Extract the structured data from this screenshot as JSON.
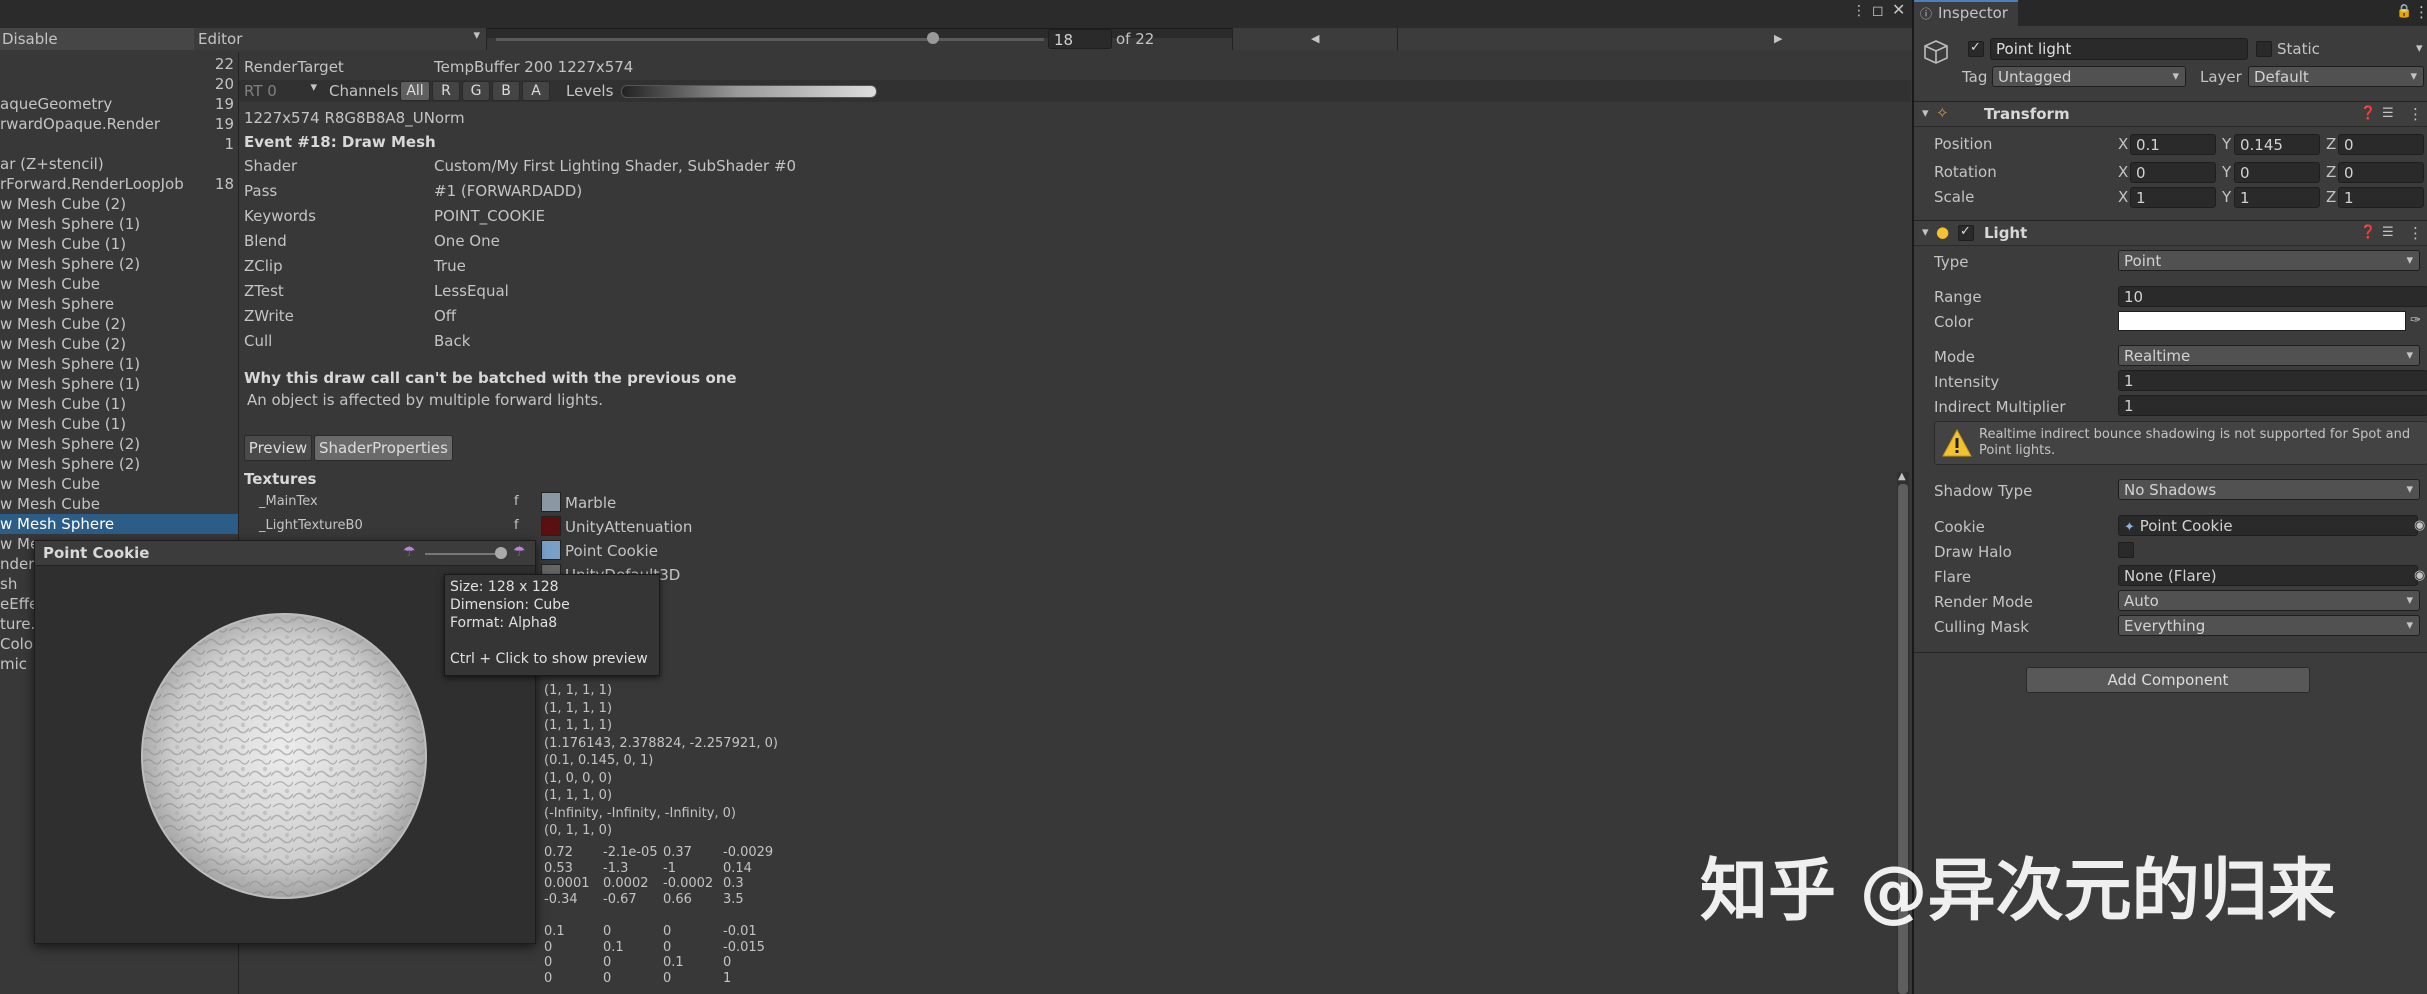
{
  "topbar": {
    "disable_label": "Disable",
    "editor_label": "Editor",
    "event_index": "18",
    "event_total": "of 22",
    "prev_icon": "triangle-left-icon",
    "next_icon": "triangle-right-icon"
  },
  "event_list": [
    {
      "label": "",
      "count": "22"
    },
    {
      "label": "",
      "count": "20"
    },
    {
      "label": "aqueGeometry",
      "count": "19"
    },
    {
      "label": "rwardOpaque.Render",
      "count": "19"
    },
    {
      "label": "",
      "count": "1"
    },
    {
      "label": "ar (Z+stencil)",
      "count": ""
    },
    {
      "label": "rForward.RenderLoopJob",
      "count": "18"
    },
    {
      "label": "w Mesh Cube (2)",
      "count": ""
    },
    {
      "label": "w Mesh Sphere (1)",
      "count": ""
    },
    {
      "label": "w Mesh Cube (1)",
      "count": ""
    },
    {
      "label": "w Mesh Sphere (2)",
      "count": ""
    },
    {
      "label": "w Mesh Cube",
      "count": ""
    },
    {
      "label": "w Mesh Sphere",
      "count": ""
    },
    {
      "label": "w Mesh Cube (2)",
      "count": ""
    },
    {
      "label": "w Mesh Cube (2)",
      "count": ""
    },
    {
      "label": "w Mesh Sphere (1)",
      "count": ""
    },
    {
      "label": "w Mesh Sphere (1)",
      "count": ""
    },
    {
      "label": "w Mesh Cube (1)",
      "count": ""
    },
    {
      "label": "w Mesh Cube (1)",
      "count": ""
    },
    {
      "label": "w Mesh Sphere (2)",
      "count": ""
    },
    {
      "label": "w Mesh Sphere (2)",
      "count": ""
    },
    {
      "label": "w Mesh Cube",
      "count": ""
    },
    {
      "label": "w Mesh Cube",
      "count": ""
    },
    {
      "label": "w Mesh Sphere",
      "count": "",
      "selected": true
    },
    {
      "label": "w Me",
      "count": ""
    },
    {
      "label": "nderS",
      "count": ""
    },
    {
      "label": "sh",
      "count": ""
    },
    {
      "label": "eEffe",
      "count": ""
    },
    {
      "label": "ture.F",
      "count": ""
    },
    {
      "label": "Color",
      "count": ""
    },
    {
      "label": "mic",
      "count": ""
    }
  ],
  "render_target": {
    "label": "RenderTarget",
    "value": "TempBuffer 200 1227x574",
    "rt_label": "RT 0",
    "channels_label": "Channels",
    "channels": [
      "All",
      "R",
      "G",
      "B",
      "A"
    ],
    "levels_label": "Levels",
    "format": "1227x574 R8G8B8A8_UNorm"
  },
  "event": {
    "title": "Event #18: Draw Mesh",
    "props": [
      {
        "name": "Shader",
        "value": "Custom/My First Lighting Shader, SubShader #0"
      },
      {
        "name": "Pass",
        "value": "#1 (FORWARDADD)"
      },
      {
        "name": "Keywords",
        "value": "POINT_COOKIE"
      },
      {
        "name": "Blend",
        "value": "One One"
      },
      {
        "name": "ZClip",
        "value": "True"
      },
      {
        "name": "ZTest",
        "value": "LessEqual"
      },
      {
        "name": "ZWrite",
        "value": "Off"
      },
      {
        "name": "Cull",
        "value": "Back"
      }
    ],
    "batch_title": "Why this draw call can't be batched with the previous one",
    "batch_reason": "An object is affected by multiple forward lights.",
    "tabs": [
      "Preview",
      "ShaderProperties"
    ],
    "textures_label": "Textures",
    "textures": [
      {
        "name": "_MainTex",
        "stage": "f",
        "value": "Marble"
      },
      {
        "name": "_LightTextureB0",
        "stage": "f",
        "value": "UnityAttenuation"
      },
      {
        "name": "",
        "stage": "",
        "value": "Point Cookie"
      },
      {
        "name": "",
        "stage": "",
        "value": "UnityDefault3D"
      }
    ],
    "vectors": [
      "(1, 1, 1, 1)",
      "(1, 1, 1, 1)",
      "(1, 1, 1, 1)",
      "(1.176143, 2.378824, -2.257921, 0)",
      "(0.1, 0.145, 0, 1)",
      "(1, 0, 0, 0)",
      "(1, 1, 1, 0)",
      "(-Infinity, -Infinity, -Infinity, 0)",
      "(0, 1, 1, 0)"
    ],
    "matrix1": [
      [
        "0.72",
        "-2.1e-05",
        "0.37",
        "-0.0029"
      ],
      [
        "0.53",
        "-1.3",
        "-1",
        "0.14"
      ],
      [
        "0.0001",
        "0.0002",
        "-0.0002",
        "0.3"
      ],
      [
        "-0.34",
        "-0.67",
        "0.66",
        "3.5"
      ]
    ],
    "matrix2": [
      [
        "0.1",
        "0",
        "0",
        "-0.01"
      ],
      [
        "0",
        "0.1",
        "0",
        "-0.015"
      ],
      [
        "0",
        "0",
        "0.1",
        "0"
      ],
      [
        "0",
        "0",
        "0",
        "1"
      ]
    ]
  },
  "cookie_popup": {
    "title": "Point Cookie",
    "tooltip": [
      "Size: 128 x 128",
      "Dimension: Cube",
      "Format: Alpha8",
      "",
      "Ctrl + Click to show preview"
    ]
  },
  "inspector": {
    "tab_label": "Inspector",
    "object_name": "Point light",
    "static_label": "Static",
    "tag_label": "Tag",
    "tag_value": "Untagged",
    "layer_label": "Layer",
    "layer_value": "Default",
    "transform_title": "Transform",
    "position_label": "Position",
    "rotation_label": "Rotation",
    "scale_label": "Scale",
    "axis_x": "X",
    "axis_y": "Y",
    "axis_z": "Z",
    "position": [
      "0.1",
      "0.145",
      "0"
    ],
    "rotation": [
      "0",
      "0",
      "0"
    ],
    "scale": [
      "1",
      "1",
      "1"
    ],
    "light_title": "Light",
    "type_label": "Type",
    "type_value": "Point",
    "range_label": "Range",
    "range_value": "10",
    "color_label": "Color",
    "color_value": "#ffffff",
    "mode_label": "Mode",
    "mode_value": "Realtime",
    "intensity_label": "Intensity",
    "intensity_value": "1",
    "indirect_label": "Indirect Multiplier",
    "indirect_value": "1",
    "warning_line1": "Realtime indirect bounce shadowing is not supported for Spot and",
    "warning_line2": "Point lights.",
    "shadow_label": "Shadow Type",
    "shadow_value": "No Shadows",
    "cookie_label": "Cookie",
    "cookie_value": "Point Cookie",
    "halo_label": "Draw Halo",
    "flare_label": "Flare",
    "flare_value": "None (Flare)",
    "render_mode_label": "Render Mode",
    "render_mode_value": "Auto",
    "culling_label": "Culling Mask",
    "culling_value": "Everything",
    "add_component_label": "Add Component"
  },
  "watermark": "知乎 @异次元的归来",
  "colors": {
    "selection": "#2c5d87",
    "panel": "#383838",
    "header": "#282828",
    "warning": "#f2c230"
  }
}
